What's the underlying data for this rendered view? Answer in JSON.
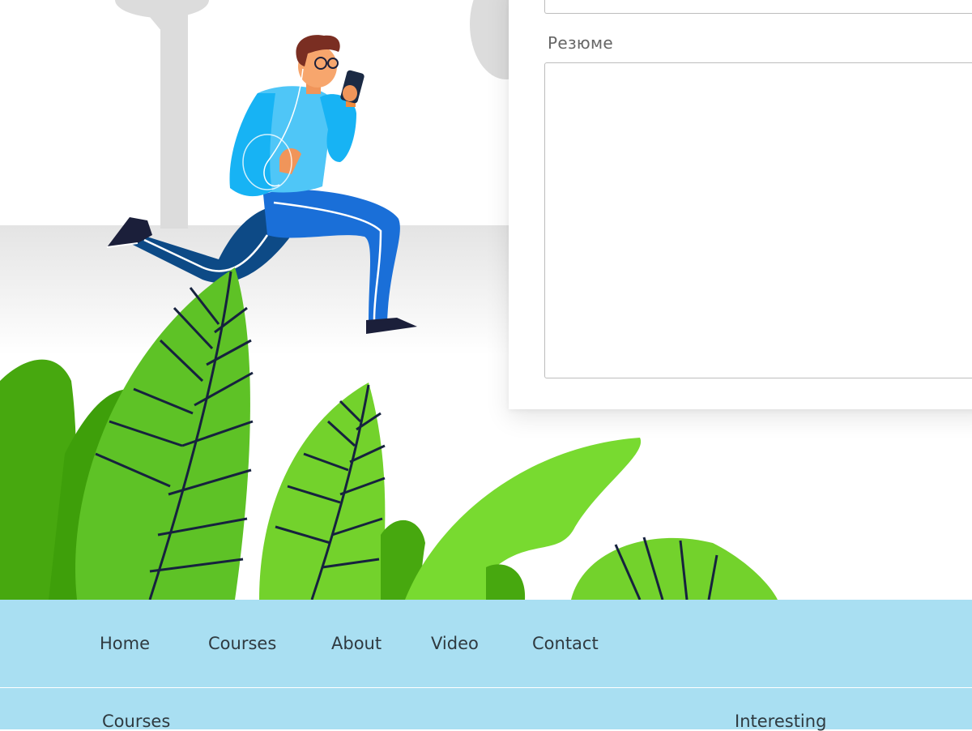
{
  "form": {
    "resume_label": "Резюме",
    "resume_value": ""
  },
  "footer": {
    "nav": [
      {
        "label": "Home"
      },
      {
        "label": "Courses"
      },
      {
        "label": "About"
      },
      {
        "label": "Video"
      },
      {
        "label": "Contact"
      }
    ],
    "columns": [
      {
        "heading": "Courses"
      },
      {
        "heading": "Interesting"
      }
    ]
  },
  "colors": {
    "footer_bg": "#a9dff2",
    "leaf_green": "#5ec226",
    "shirt_blue": "#17b3f4",
    "pants_blue": "#1a6fd8"
  }
}
